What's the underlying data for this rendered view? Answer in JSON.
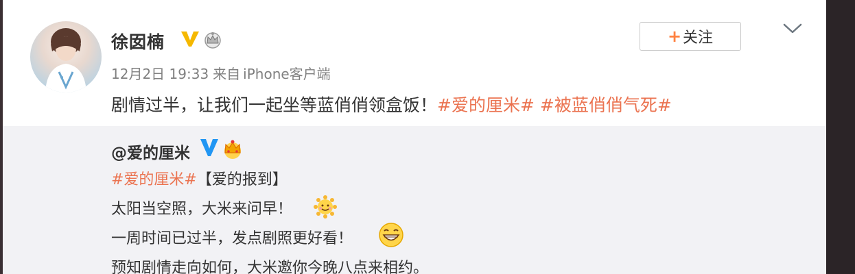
{
  "post": {
    "username": "徐囡楠",
    "time": "12月2日 19:33",
    "source_prefix": "来自",
    "source": "iPhone客户端",
    "text_plain": "剧情过半，让我们一起坐等蓝俏俏领盒饭！",
    "tags": [
      "#爱的厘米#",
      "#被蓝俏俏气死#"
    ]
  },
  "actions": {
    "follow_plus": "+",
    "follow_label": "关注"
  },
  "icons": {
    "verified": "v-verified-icon",
    "member": "crown-badge-icon",
    "expand": "chevron-down-icon",
    "accent": "#eb7350",
    "verified_gold": "#f5b800",
    "verified_blue": "#2196f3"
  },
  "quoted": {
    "username": "@爱的厘米",
    "tag": "#爱的厘米#",
    "bracket": "【爱的报到】",
    "line1": "太阳当空照，大米来问早！",
    "line2": "一周时间已过半，发点剧照更好看！",
    "line3": "预知剧情走向如何，大米邀你今晚八点来相约。"
  }
}
